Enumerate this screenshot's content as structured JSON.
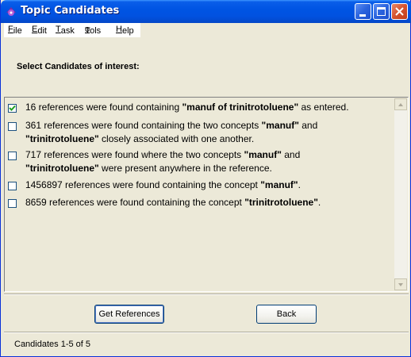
{
  "window": {
    "title": "Topic Candidates",
    "accent": "#0054e3"
  },
  "menu": [
    {
      "pre": "",
      "u": "F",
      "post": "ile"
    },
    {
      "pre": "",
      "u": "E",
      "post": "dit"
    },
    {
      "pre": "",
      "u": "T",
      "post": "ask"
    },
    {
      "pre": "T",
      "u": "o",
      "post": "ols"
    },
    {
      "pre": "",
      "u": "H",
      "post": "elp"
    }
  ],
  "prompt": "Select Candidates of interest:",
  "candidates": [
    {
      "checked": true,
      "lines": [
        [
          {
            "t": "16 references were found containing "
          },
          {
            "t": "\"manuf of trinitrotoluene\"",
            "b": true
          },
          {
            "t": " as entered."
          }
        ]
      ]
    },
    {
      "checked": false,
      "lines": [
        [
          {
            "t": "361 references were found containing the two concepts "
          },
          {
            "t": "\"manuf\"",
            "b": true
          },
          {
            "t": " and"
          }
        ],
        [
          {
            "t": "\"trinitrotoluene\"",
            "b": true
          },
          {
            "t": " closely associated with one another."
          }
        ]
      ]
    },
    {
      "checked": false,
      "lines": [
        [
          {
            "t": "717 references were found where the two concepts "
          },
          {
            "t": "\"manuf\"",
            "b": true
          },
          {
            "t": " and"
          }
        ],
        [
          {
            "t": "\"trinitrotoluene\"",
            "b": true
          },
          {
            "t": " were present anywhere in the reference."
          }
        ]
      ]
    },
    {
      "checked": false,
      "lines": [
        [
          {
            "t": "1456897 references were found containing the concept "
          },
          {
            "t": "\"manuf\"",
            "b": true
          },
          {
            "t": "."
          }
        ]
      ]
    },
    {
      "checked": false,
      "lines": [
        [
          {
            "t": "8659 references were found containing the concept "
          },
          {
            "t": "\"trinitrotoluene\"",
            "b": true
          },
          {
            "t": "."
          }
        ]
      ]
    }
  ],
  "buttons": {
    "get_references": "Get References",
    "back": "Back"
  },
  "status": "Candidates 1-5 of 5"
}
